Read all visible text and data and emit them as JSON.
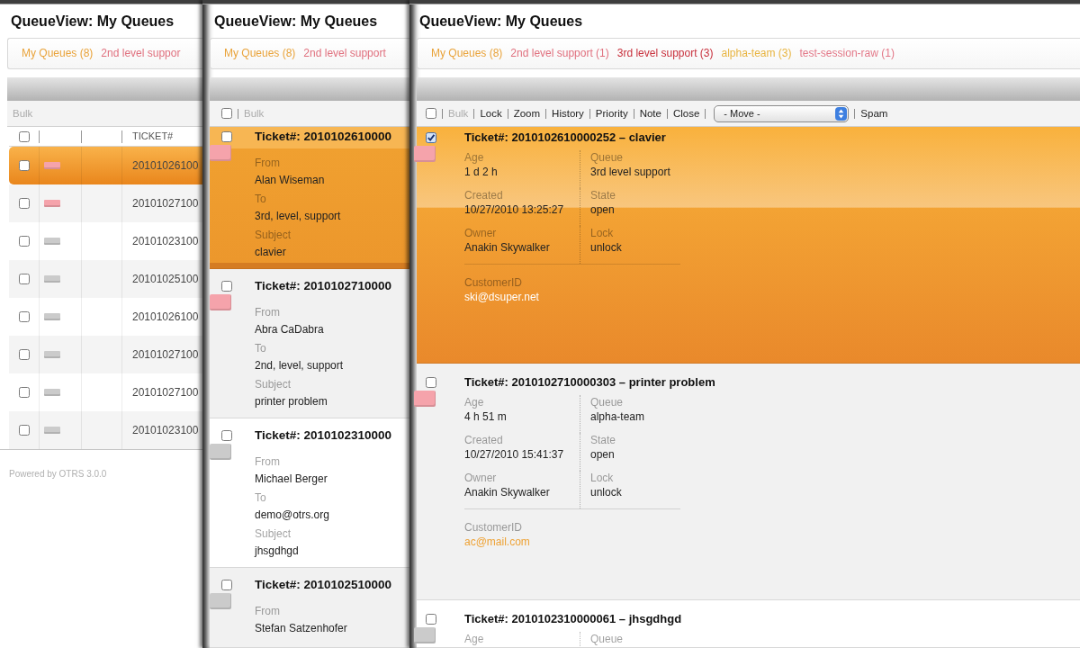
{
  "panels": [
    {
      "kind": "small",
      "title": "QueueView: My Queues",
      "queues": [
        {
          "label": "My Queues (8)",
          "color": "#e9a33a"
        },
        {
          "label": "2nd level suppor",
          "color": "#e0707e"
        }
      ],
      "actions": [
        {
          "kind": "link",
          "label": "Bulk",
          "disabled": true
        }
      ],
      "table": {
        "select_all": {
          "checked": false
        },
        "columns": [
          "TICKET#"
        ],
        "rows": [
          {
            "selected": true,
            "checked": false,
            "color": "#f5a3ab",
            "number": "20101026100"
          },
          {
            "selected": false,
            "checked": false,
            "color": "#f5a3ab",
            "number": "20101027100"
          },
          {
            "selected": false,
            "checked": false,
            "color": "#cbcbcb",
            "number": "20101023100"
          },
          {
            "selected": false,
            "checked": false,
            "color": "#cbcbcb",
            "number": "20101025100"
          },
          {
            "selected": false,
            "checked": false,
            "color": "#cbcbcb",
            "number": "20101026100"
          },
          {
            "selected": false,
            "checked": false,
            "color": "#cbcbcb",
            "number": "20101027100"
          },
          {
            "selected": false,
            "checked": false,
            "color": "#cbcbcb",
            "number": "20101027100"
          },
          {
            "selected": false,
            "checked": false,
            "color": "#cbcbcb",
            "number": "20101023100"
          }
        ]
      },
      "footer": "Powered by OTRS 3.0.0"
    },
    {
      "kind": "medium",
      "title": "QueueView: My Queues",
      "queues": [
        {
          "label": "My Queues (8)",
          "color": "#e9a33a"
        },
        {
          "label": "2nd level support",
          "color": "#e0707e"
        }
      ],
      "actions": [
        {
          "kind": "checkbox",
          "checked": false
        },
        {
          "kind": "link",
          "label": "Bulk",
          "disabled": true
        }
      ],
      "tickets": [
        {
          "selected": true,
          "checked": false,
          "color": "#f5a3ab",
          "title": "Ticket#: 2010102610000",
          "fields": [
            {
              "label": "From",
              "value": "Alan Wiseman"
            },
            {
              "label": "To",
              "value": "3rd, level, support"
            },
            {
              "label": "Subject",
              "value": "clavier"
            }
          ]
        },
        {
          "selected": false,
          "checked": false,
          "color": "#f5a3ab",
          "title": "Ticket#: 2010102710000",
          "fields": [
            {
              "label": "From",
              "value": "Abra CaDabra"
            },
            {
              "label": "To",
              "value": "2nd, level, support"
            },
            {
              "label": "Subject",
              "value": "printer problem"
            }
          ]
        },
        {
          "selected": false,
          "checked": false,
          "color": "#cbcbcb",
          "title": "Ticket#: 2010102310000",
          "fields": [
            {
              "label": "From",
              "value": "Michael Berger"
            },
            {
              "label": "To",
              "value": "demo@otrs.org"
            },
            {
              "label": "Subject",
              "value": "jhsgdhgd"
            }
          ]
        },
        {
          "selected": false,
          "checked": false,
          "color": "#cbcbcb",
          "title": "Ticket#: 2010102510000",
          "fields": [
            {
              "label": "From",
              "value": "Stefan Satzenhofer"
            }
          ]
        }
      ]
    },
    {
      "kind": "large",
      "title": "QueueView: My Queues",
      "queues": [
        {
          "label": "My Queues (8)",
          "color": "#e9a33a"
        },
        {
          "label": "2nd level support (1)",
          "color": "#e0707e"
        },
        {
          "label": "3rd level support (3)",
          "color": "#c8303c"
        },
        {
          "label": "alpha-team (3)",
          "color": "#e8b440"
        },
        {
          "label": "test-session-raw (1)",
          "color": "#e37888"
        }
      ],
      "actions": [
        {
          "kind": "checkbox",
          "checked": false
        },
        {
          "kind": "link",
          "label": "Bulk",
          "disabled": true
        },
        {
          "kind": "link",
          "label": "Lock",
          "disabled": false
        },
        {
          "kind": "link",
          "label": "Zoom",
          "disabled": false
        },
        {
          "kind": "link",
          "label": "History",
          "disabled": false
        },
        {
          "kind": "link",
          "label": "Priority",
          "disabled": false
        },
        {
          "kind": "link",
          "label": "Note",
          "disabled": false
        },
        {
          "kind": "link",
          "label": "Close",
          "disabled": false
        },
        {
          "kind": "select",
          "value": "- Move -"
        },
        {
          "kind": "link",
          "label": "Spam",
          "disabled": false
        }
      ],
      "tickets": [
        {
          "selected": true,
          "checked": true,
          "color": "#f5a3ab",
          "title": "Ticket#: 2010102610000252 – clavier",
          "fields": [
            {
              "label": "Age",
              "value": "1 d 2 h"
            },
            {
              "label": "Queue",
              "value": "3rd level support"
            },
            {
              "label": "Created",
              "value": "10/27/2010 13:25:27"
            },
            {
              "label": "State",
              "value": "open"
            },
            {
              "label": "Owner",
              "value": "Anakin Skywalker"
            },
            {
              "label": "Lock",
              "value": "unlock"
            }
          ],
          "customer": {
            "label": "CustomerID",
            "value": "ski@dsuper.net"
          }
        },
        {
          "selected": false,
          "checked": false,
          "color": "#f5a3ab",
          "title": "Ticket#: 2010102710000303 – printer problem",
          "fields": [
            {
              "label": "Age",
              "value": "4 h 51 m"
            },
            {
              "label": "Queue",
              "value": "alpha-team"
            },
            {
              "label": "Created",
              "value": "10/27/2010 15:41:37"
            },
            {
              "label": "State",
              "value": "open"
            },
            {
              "label": "Owner",
              "value": "Anakin Skywalker"
            },
            {
              "label": "Lock",
              "value": "unlock"
            }
          ],
          "customer": {
            "label": "CustomerID",
            "value": "ac@mail.com"
          }
        },
        {
          "selected": false,
          "checked": false,
          "color": "#cbcbcb",
          "title": "Ticket#: 2010102310000061 – jhsgdhgd",
          "fields": [
            {
              "label": "Age"
            },
            {
              "label": "Queue"
            }
          ]
        }
      ]
    }
  ]
}
